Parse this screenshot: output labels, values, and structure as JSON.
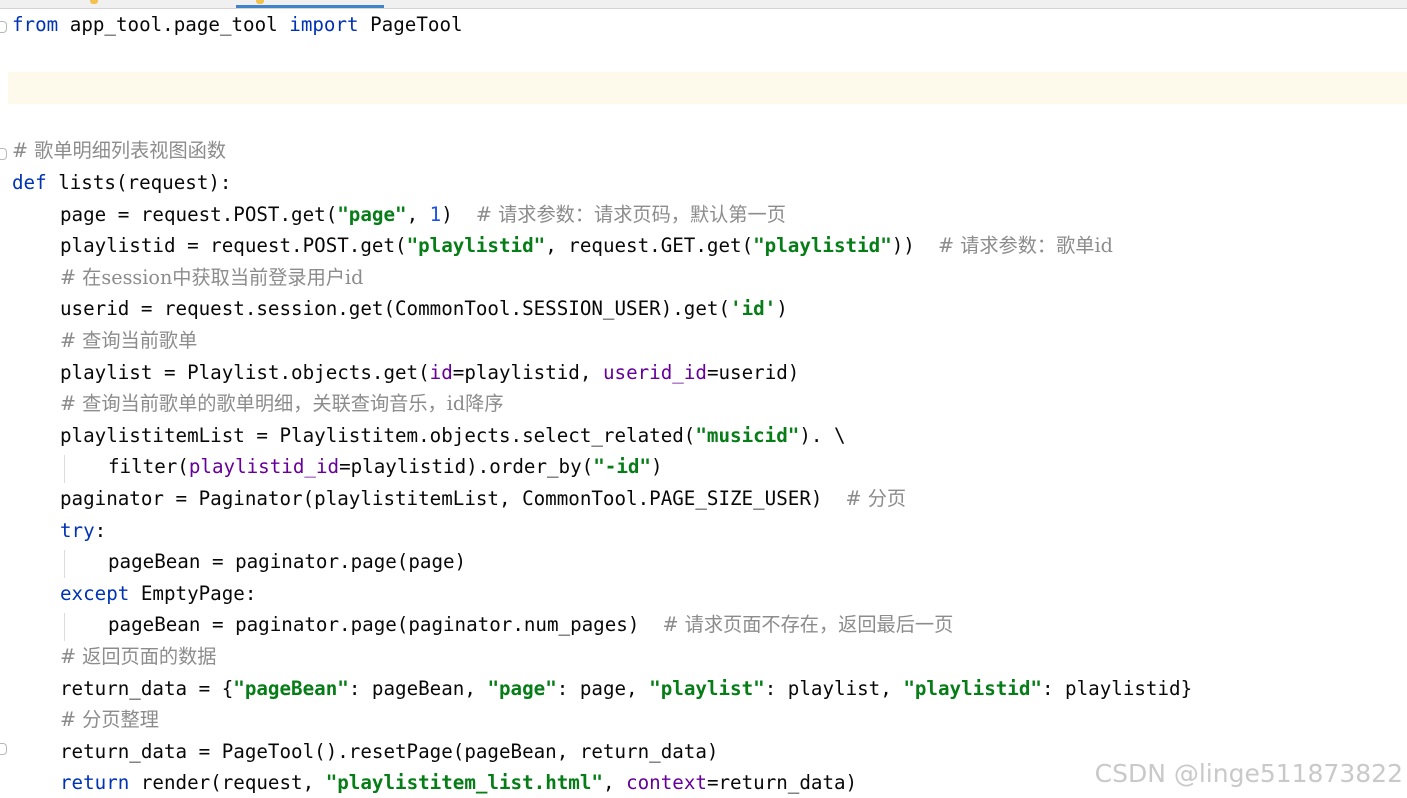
{
  "watermark": "CSDN @linge511873822",
  "lines": [
    {
      "indent": 0,
      "tokens": [
        {
          "c": "kw",
          "t": "from"
        },
        {
          "c": "",
          "t": " app_tool.page_tool "
        },
        {
          "c": "kw",
          "t": "import"
        },
        {
          "c": "",
          "t": " PageTool"
        }
      ]
    },
    {
      "indent": 0,
      "tokens": []
    },
    {
      "indent": 0,
      "tokens": []
    },
    {
      "indent": 0,
      "tokens": []
    },
    {
      "indent": 0,
      "tokens": [
        {
          "c": "cm",
          "t": "# 歌单明细列表视图函数"
        }
      ]
    },
    {
      "indent": 0,
      "tokens": [
        {
          "c": "kw",
          "t": "def"
        },
        {
          "c": "",
          "t": " lists(request):"
        }
      ]
    },
    {
      "indent": 1,
      "tokens": [
        {
          "c": "",
          "t": "page = request.POST.get("
        },
        {
          "c": "str",
          "t": "\"page\""
        },
        {
          "c": "",
          "t": ", "
        },
        {
          "c": "num",
          "t": "1"
        },
        {
          "c": "",
          "t": ")  "
        },
        {
          "c": "cm",
          "t": "# 请求参数：请求页码，默认第一页"
        }
      ]
    },
    {
      "indent": 1,
      "tokens": [
        {
          "c": "",
          "t": "playlistid = request.POST.get("
        },
        {
          "c": "str",
          "t": "\"playlistid\""
        },
        {
          "c": "",
          "t": ", request.GET.get("
        },
        {
          "c": "str",
          "t": "\"playlistid\""
        },
        {
          "c": "",
          "t": "))  "
        },
        {
          "c": "cm",
          "t": "# 请求参数：歌单id"
        }
      ]
    },
    {
      "indent": 1,
      "tokens": [
        {
          "c": "cm",
          "t": "# 在session中获取当前登录用户id"
        }
      ]
    },
    {
      "indent": 1,
      "tokens": [
        {
          "c": "",
          "t": "userid = request.session.get(CommonTool.SESSION_USER).get("
        },
        {
          "c": "str",
          "t": "'id'"
        },
        {
          "c": "",
          "t": ")"
        }
      ]
    },
    {
      "indent": 1,
      "tokens": [
        {
          "c": "cm",
          "t": "# 查询当前歌单"
        }
      ]
    },
    {
      "indent": 1,
      "tokens": [
        {
          "c": "",
          "t": "playlist = Playlist.objects.get("
        },
        {
          "c": "kwarg",
          "t": "id"
        },
        {
          "c": "",
          "t": "=playlistid, "
        },
        {
          "c": "kwarg",
          "t": "userid_id"
        },
        {
          "c": "",
          "t": "=userid)"
        }
      ]
    },
    {
      "indent": 1,
      "tokens": [
        {
          "c": "cm",
          "t": "# 查询当前歌单的歌单明细，关联查询音乐，id降序"
        }
      ]
    },
    {
      "indent": 1,
      "tokens": [
        {
          "c": "",
          "t": "playlistitemList = Playlistitem.objects.select_related("
        },
        {
          "c": "str",
          "t": "\"musicid\""
        },
        {
          "c": "",
          "t": "). \\"
        }
      ]
    },
    {
      "indent": 2,
      "tokens": [
        {
          "c": "",
          "t": "filter("
        },
        {
          "c": "kwarg",
          "t": "playlistid_id"
        },
        {
          "c": "",
          "t": "=playlistid).order_by("
        },
        {
          "c": "str",
          "t": "\"-id\""
        },
        {
          "c": "",
          "t": ")"
        }
      ]
    },
    {
      "indent": 1,
      "tokens": [
        {
          "c": "",
          "t": "paginator = Paginator(playlistitemList, CommonTool.PAGE_SIZE_USER)  "
        },
        {
          "c": "cm",
          "t": "# 分页"
        }
      ]
    },
    {
      "indent": 1,
      "tokens": [
        {
          "c": "kw",
          "t": "try"
        },
        {
          "c": "",
          "t": ":"
        }
      ]
    },
    {
      "indent": 2,
      "tokens": [
        {
          "c": "",
          "t": "pageBean = paginator.page(page)"
        }
      ]
    },
    {
      "indent": 1,
      "tokens": [
        {
          "c": "kw",
          "t": "except"
        },
        {
          "c": "",
          "t": " EmptyPage:"
        }
      ]
    },
    {
      "indent": 2,
      "tokens": [
        {
          "c": "",
          "t": "pageBean = paginator.page(paginator.num_pages)  "
        },
        {
          "c": "cm",
          "t": "# 请求页面不存在，返回最后一页"
        }
      ]
    },
    {
      "indent": 1,
      "tokens": [
        {
          "c": "cm",
          "t": "# 返回页面的数据"
        }
      ]
    },
    {
      "indent": 1,
      "tokens": [
        {
          "c": "",
          "t": "return_data = {"
        },
        {
          "c": "str",
          "t": "\"pageBean\""
        },
        {
          "c": "",
          "t": ": pageBean, "
        },
        {
          "c": "str",
          "t": "\"page\""
        },
        {
          "c": "",
          "t": ": page, "
        },
        {
          "c": "str",
          "t": "\"playlist\""
        },
        {
          "c": "",
          "t": ": playlist, "
        },
        {
          "c": "str",
          "t": "\"playlistid\""
        },
        {
          "c": "",
          "t": ": playlistid}"
        }
      ]
    },
    {
      "indent": 1,
      "tokens": [
        {
          "c": "cm",
          "t": "# 分页整理"
        }
      ]
    },
    {
      "indent": 1,
      "tokens": [
        {
          "c": "",
          "t": "return_data = PageTool().resetPage(pageBean, return_data)"
        }
      ]
    },
    {
      "indent": 1,
      "tokens": [
        {
          "c": "kw",
          "t": "return"
        },
        {
          "c": "",
          "t": " render(request, "
        },
        {
          "c": "str",
          "t": "\"playlistitem_list.html\""
        },
        {
          "c": "",
          "t": ", "
        },
        {
          "c": "kwarg",
          "t": "context"
        },
        {
          "c": "",
          "t": "=return_data)"
        }
      ]
    }
  ],
  "colors": {
    "keyword": "#0033b3",
    "string": "#067d17",
    "number": "#1750eb",
    "comment": "#8c8c8c",
    "kwarg": "#660099",
    "current_line": "#fdfaec"
  }
}
